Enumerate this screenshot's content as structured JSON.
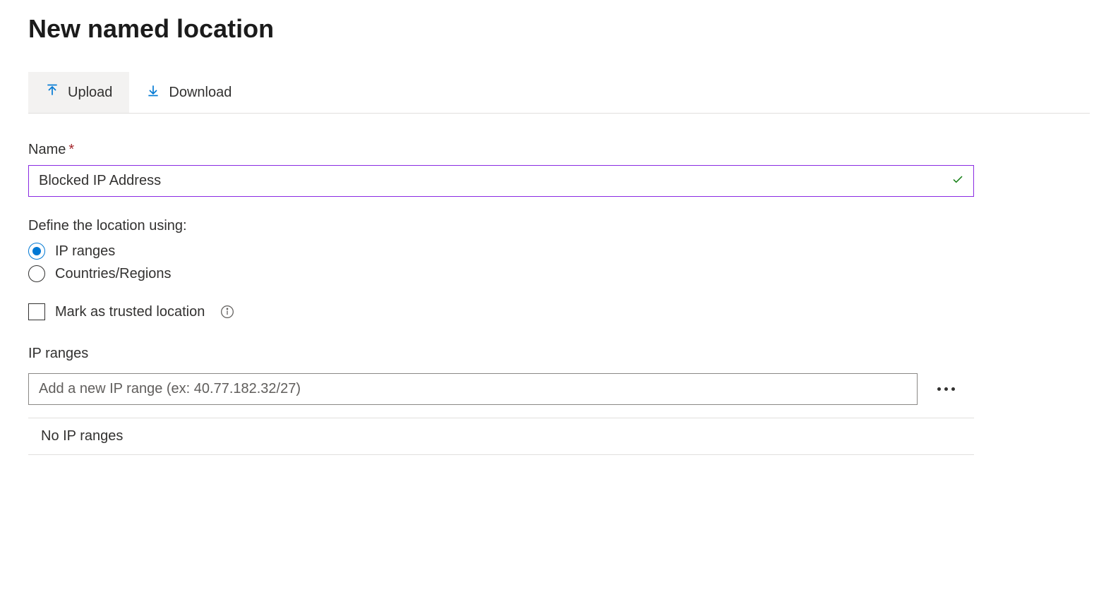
{
  "page": {
    "title": "New named location"
  },
  "toolbar": {
    "upload_label": "Upload",
    "download_label": "Download"
  },
  "form": {
    "name_label": "Name",
    "name_value": "Blocked IP Address",
    "define_heading": "Define the location using:",
    "radio_ip_ranges": "IP ranges",
    "radio_countries": "Countries/Regions",
    "trusted_label": "Mark as trusted location",
    "ip_ranges_heading": "IP ranges",
    "ip_input_placeholder": "Add a new IP range (ex: 40.77.182.32/27)",
    "empty_message": "No IP ranges"
  }
}
